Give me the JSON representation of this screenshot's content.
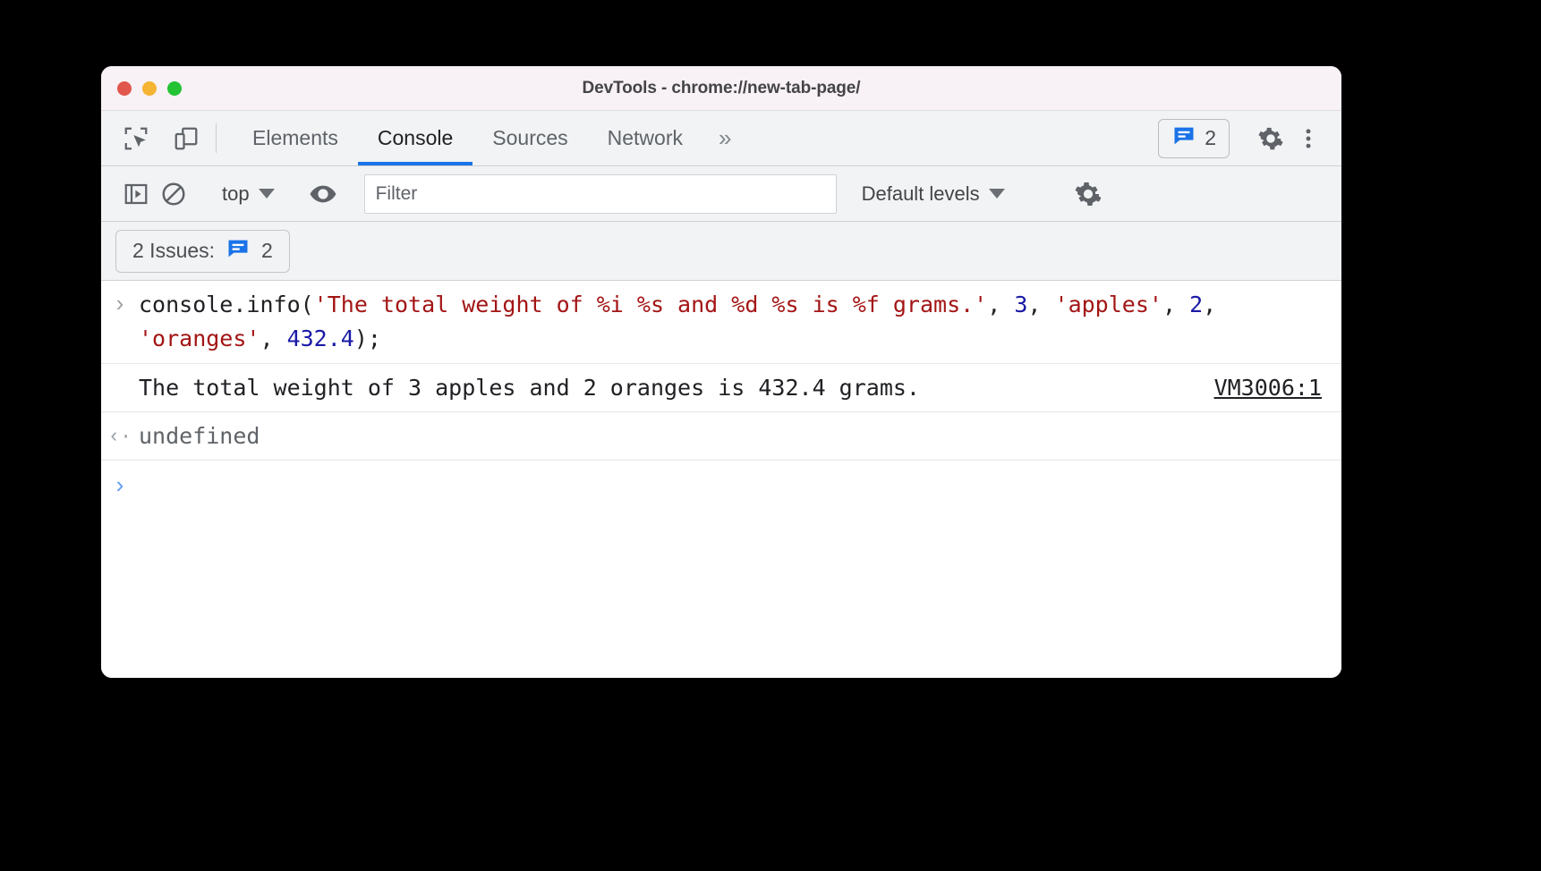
{
  "window": {
    "title": "DevTools - chrome://new-tab-page/",
    "traffic_lights": [
      {
        "name": "close",
        "color": "#e2574d"
      },
      {
        "name": "minimize",
        "color": "#f5b433"
      },
      {
        "name": "zoom",
        "color": "#23c333"
      }
    ]
  },
  "tabbar": {
    "inspect_icon": "inspect-element-icon",
    "device_icon": "device-toolbar-icon",
    "tabs": [
      {
        "label": "Elements",
        "active": false
      },
      {
        "label": "Console",
        "active": true
      },
      {
        "label": "Sources",
        "active": false
      },
      {
        "label": "Network",
        "active": false
      }
    ],
    "more_tabs_label": "»",
    "issues_count": "2",
    "issues_icon": "message-bubble-icon",
    "settings_icon": "gear-icon",
    "more_icon": "kebab-menu-icon"
  },
  "console_toolbar": {
    "sidebar_toggle_icon": "console-sidebar-icon",
    "clear_icon": "clear-console-icon",
    "context": "top",
    "eye_icon": "live-expression-icon",
    "filter_placeholder": "Filter",
    "filter_value": "",
    "levels": "Default levels",
    "settings_icon": "gear-icon"
  },
  "issues_bar": {
    "label": "2 Issues:",
    "icon": "message-bubble-icon",
    "count": "2"
  },
  "console": {
    "input_prompt": "›",
    "input_tokens": [
      {
        "t": "plain",
        "v": "console.info("
      },
      {
        "t": "str",
        "v": "'The total weight of %i %s and %d %s is %f grams.'"
      },
      {
        "t": "plain",
        "v": ", "
      },
      {
        "t": "num",
        "v": "3"
      },
      {
        "t": "plain",
        "v": ", "
      },
      {
        "t": "str",
        "v": "'apples'"
      },
      {
        "t": "plain",
        "v": ", "
      },
      {
        "t": "num",
        "v": "2"
      },
      {
        "t": "plain",
        "v": ", "
      },
      {
        "t": "str",
        "v": "'oranges'"
      },
      {
        "t": "plain",
        "v": ", "
      },
      {
        "t": "num",
        "v": "432.4"
      },
      {
        "t": "plain",
        "v": ");"
      }
    ],
    "output_text": "The total weight of 3 apples and 2 oranges is 432.4 grams.",
    "output_source": "VM3006:1",
    "return_prompt": "‹·",
    "return_value": "undefined",
    "empty_prompt": "›"
  },
  "colors": {
    "accent_blue": "#1a73e8",
    "issue_blue": "#1a73e8",
    "string_red": "#a31515",
    "number_blue": "#1a1aa6",
    "toolbar_bg": "#f1f3f4",
    "titlebar_bg": "#f8f1f5"
  }
}
